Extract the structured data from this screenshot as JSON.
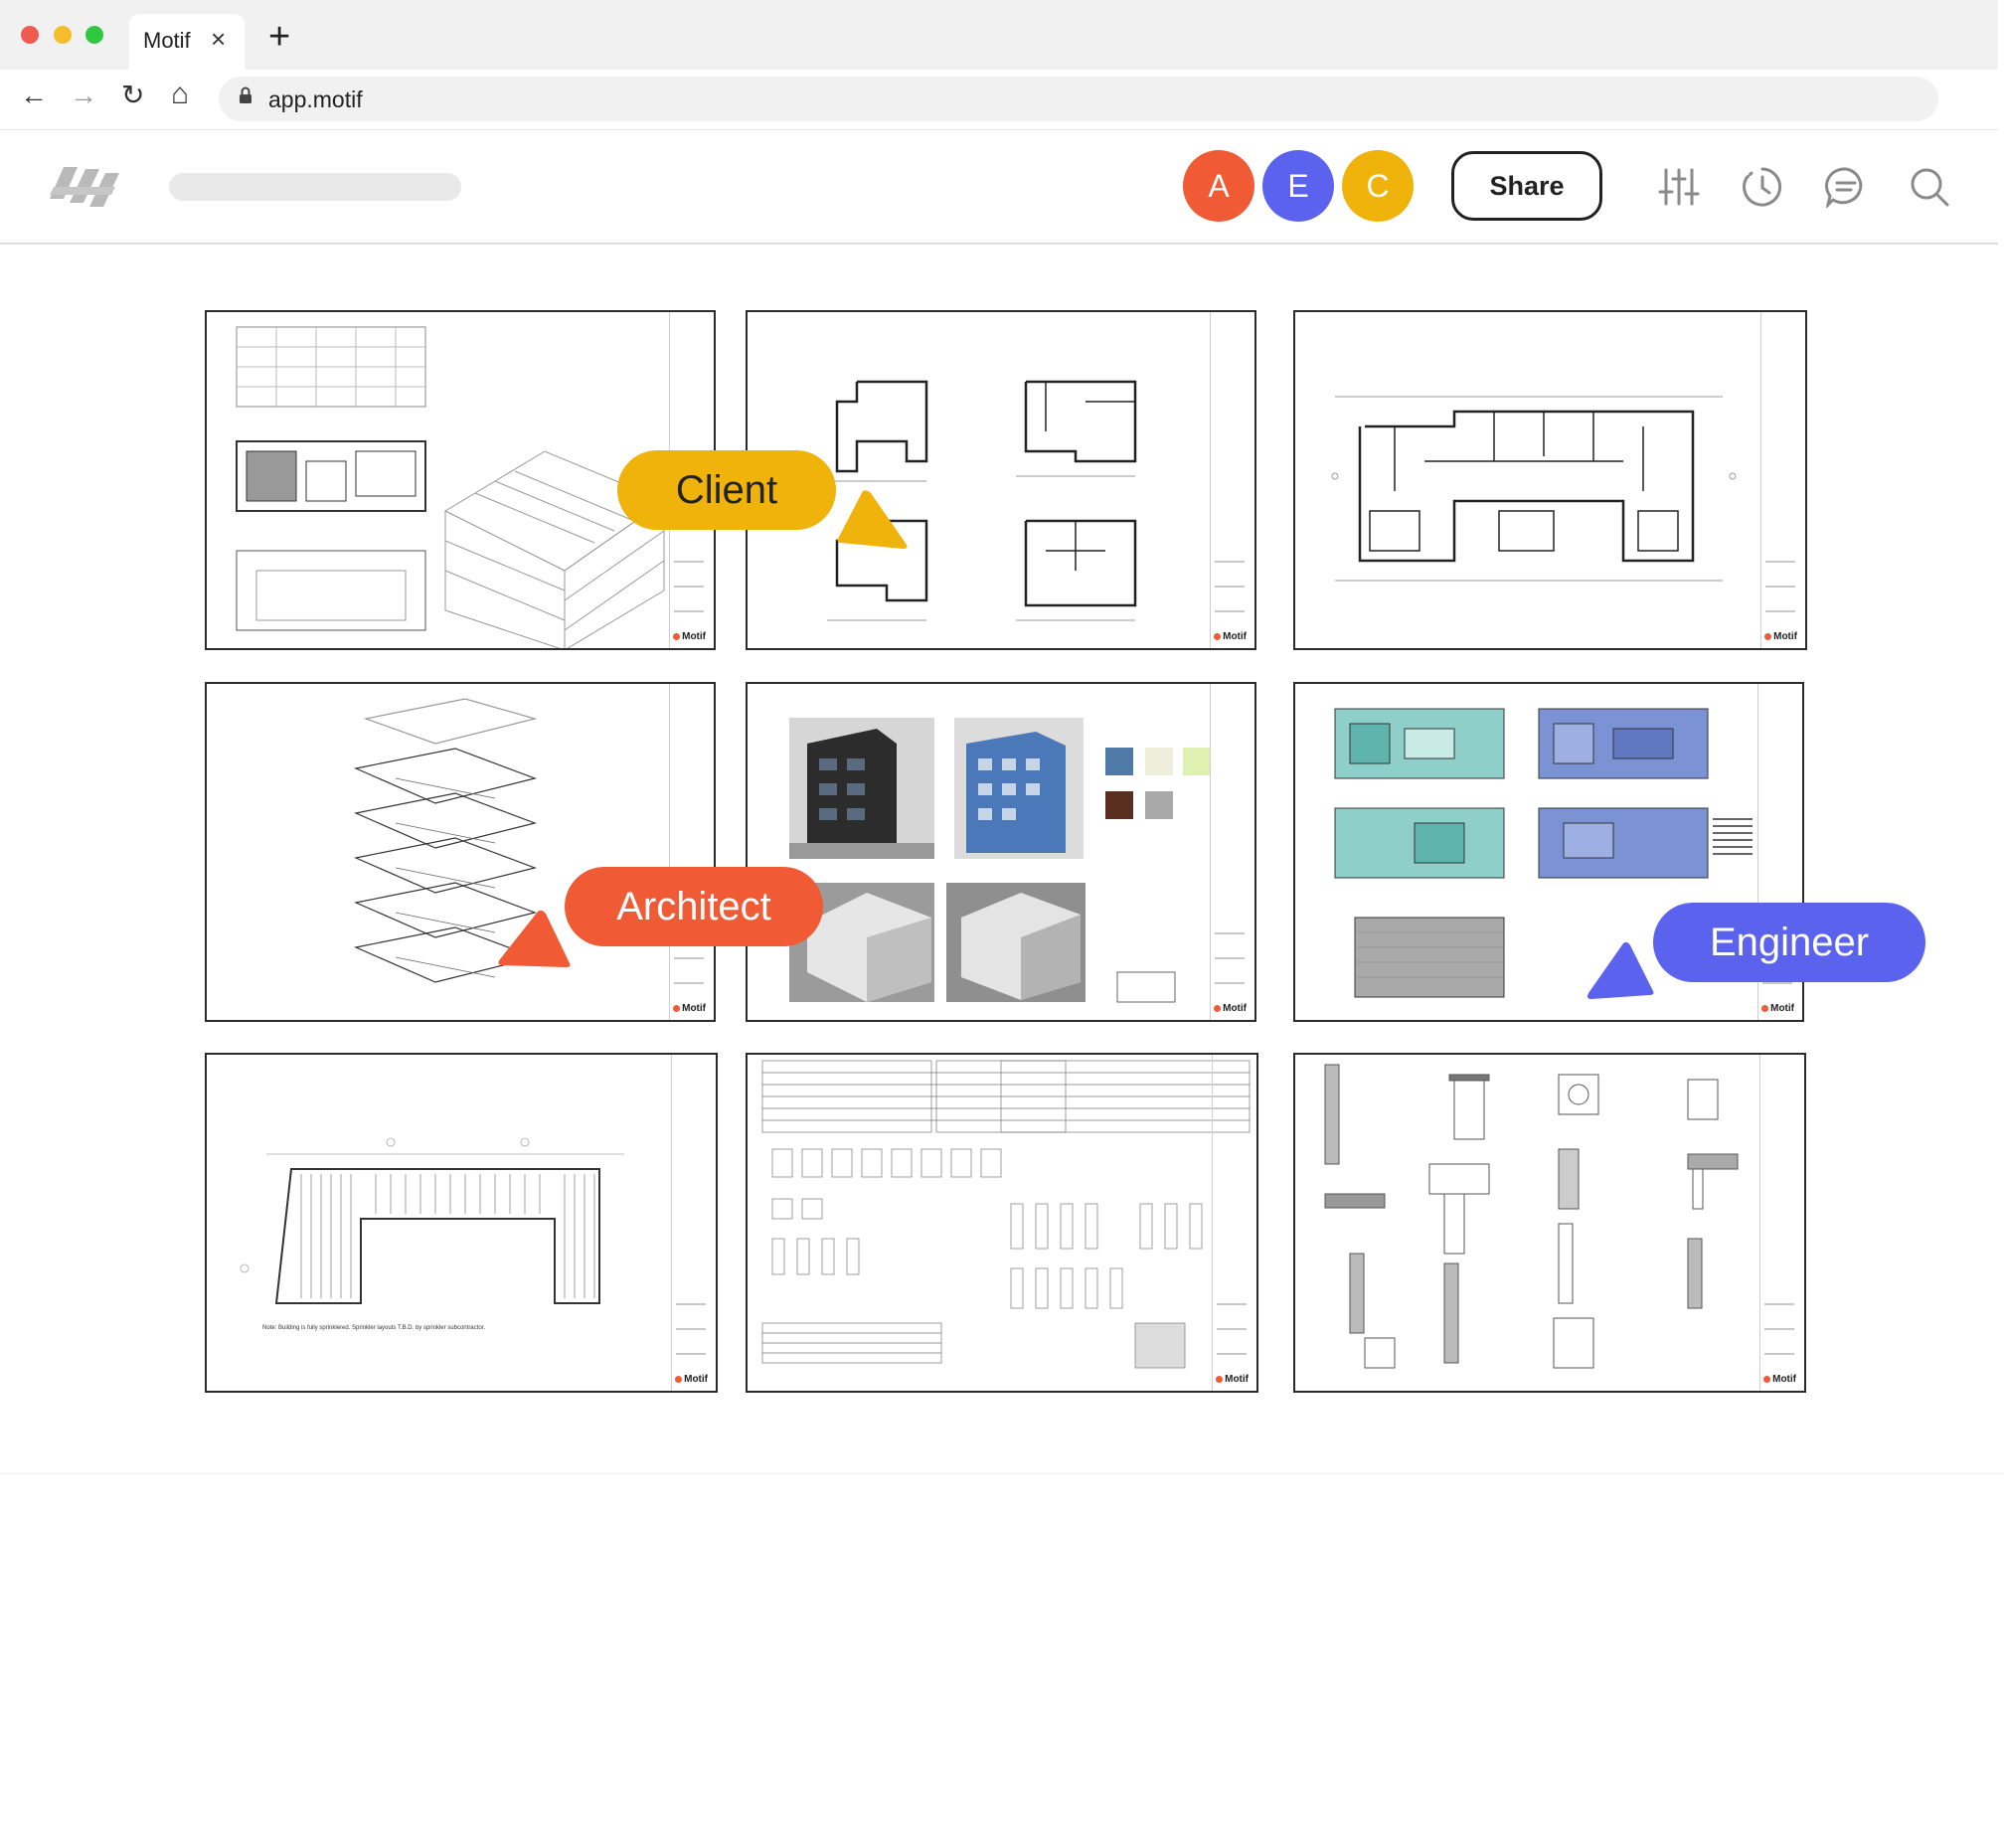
{
  "browser": {
    "tab_title": "Motif",
    "tab_close": "×",
    "new_tab": "+",
    "url": "app.motif",
    "back": "←",
    "forward": "→",
    "reload": "↻",
    "home": "⌂",
    "lock": "🔒"
  },
  "app": {
    "collaborators": [
      {
        "initial": "A",
        "color": "#f05a35"
      },
      {
        "initial": "E",
        "color": "#5b62ee"
      },
      {
        "initial": "C",
        "color": "#efb30b"
      }
    ],
    "share_label": "Share",
    "icons": [
      "sliders-icon",
      "history-clock-icon",
      "comment-icon",
      "search-icon"
    ]
  },
  "sheets": [
    {
      "name": "sheet-massing-isometric",
      "mark": "Motif"
    },
    {
      "name": "sheet-unit-plans",
      "mark": "Motif"
    },
    {
      "name": "sheet-floor-plan",
      "mark": "Motif"
    },
    {
      "name": "sheet-exploded-axonometric",
      "mark": "Motif"
    },
    {
      "name": "sheet-renderings-materials",
      "mark": "Motif"
    },
    {
      "name": "sheet-colored-area-plans",
      "mark": "Motif"
    },
    {
      "name": "sheet-ceiling-plan",
      "mark": "Motif",
      "note": "Note: Building is fully sprinklered. Sprinkler layouts T.B.D. by sprinkler subcontractor."
    },
    {
      "name": "sheet-door-window-schedule",
      "mark": "Motif"
    },
    {
      "name": "sheet-details",
      "mark": "Motif"
    }
  ],
  "cursors": {
    "client": {
      "label": "Client",
      "color": "#efb30b"
    },
    "architect": {
      "label": "Architect",
      "color": "#f05a35"
    },
    "engineer": {
      "label": "Engineer",
      "color": "#5b62ee"
    }
  }
}
